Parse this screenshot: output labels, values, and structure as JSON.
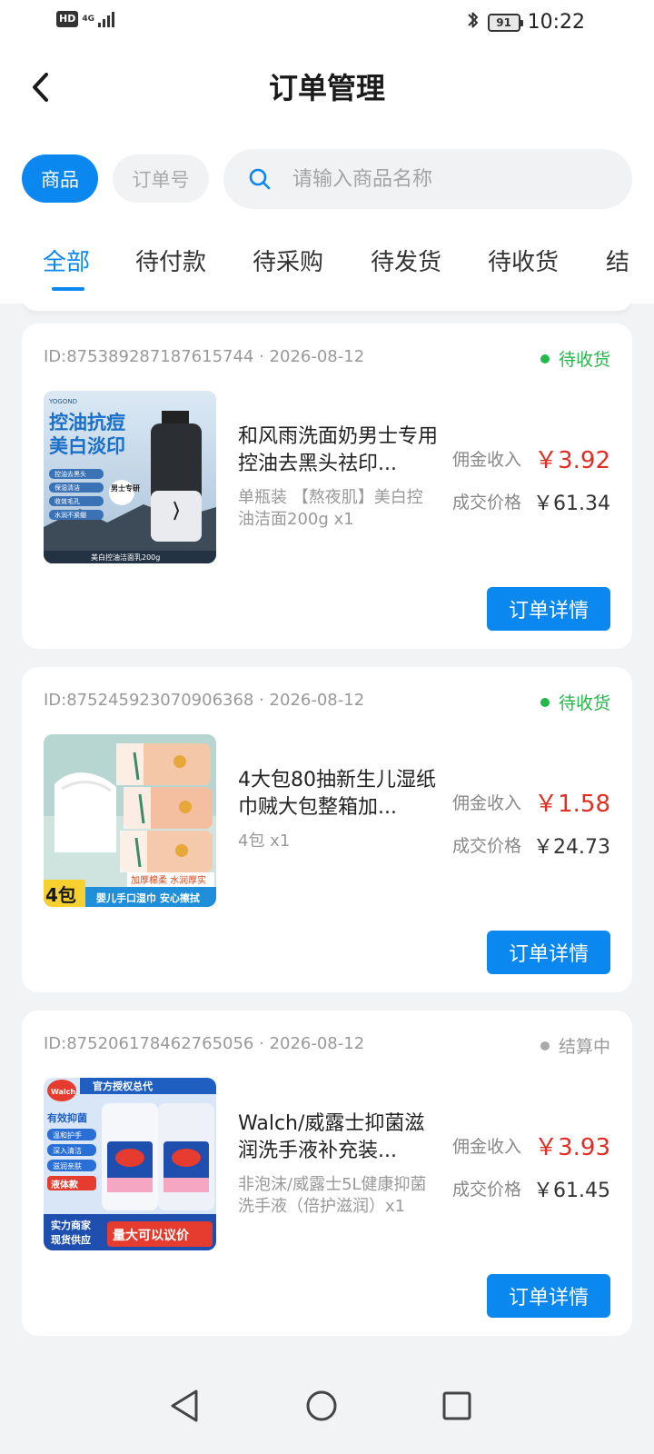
{
  "status_bar": {
    "network": "4G",
    "hd": "HD",
    "battery": "91",
    "time": "10:22"
  },
  "header": {
    "title": "订单管理"
  },
  "search": {
    "mode_goods": "商品",
    "mode_order_no": "订单号",
    "placeholder": "请输入商品名称"
  },
  "tabs": [
    "全部",
    "待付款",
    "待采购",
    "待发货",
    "待收货",
    "结"
  ],
  "labels": {
    "commission": "佣金收入",
    "deal_price": "成交价格",
    "detail_button": "订单详情"
  },
  "orders": [
    {
      "id_line": "ID:875389287187615744 · 2026-08-12",
      "status": "待收货",
      "status_color": "#22b84a",
      "name": "和风雨洗面奶男士专用控油去黑头祛印...",
      "sku": "单瓶装 【熬夜肌】美白控油洁面200g x1",
      "commission": "￥3.92",
      "price": "￥61.34",
      "image": {
        "brand": "YOGOND",
        "l1": "控油抗痘",
        "l2": "美白淡印",
        "f1": "控油去黑头",
        "f2": "保湿清洁",
        "f3": "收敛毛孔",
        "f4": "水润不紧绷",
        "badge": "男士专研",
        "caption": "美白控油洁面乳200g"
      }
    },
    {
      "id_line": "ID:875245923070906368 · 2026-08-12",
      "status": "待收货",
      "status_color": "#22b84a",
      "name": "4大包80抽新生儿湿纸巾贼大包整箱加...",
      "sku": "4包 x1",
      "commission": "￥1.58",
      "price": "￥24.73",
      "image": {
        "big": "4包",
        "tag": "加厚棉柔 水润厚实",
        "caption": "婴儿手口湿巾 安心擦拭"
      }
    },
    {
      "id_line": "ID:875206178462765056 · 2026-08-12",
      "status": "结算中",
      "status_color": "#aaaaaa",
      "name": "Walch/威露士抑菌滋润洗手液补充装...",
      "sku": "非泡沫/威露士5L健康抑菌洗手液（倍护滋润）x1",
      "commission": "￥3.93",
      "price": "￥61.45",
      "image": {
        "top": "官方授权总代",
        "brand": "Walch",
        "f0": "有效抑菌",
        "f1": "温和护手",
        "f2": "深入清洁",
        "f3": "滋润亲肤",
        "f4": "液体款",
        "b1": "实力商家",
        "b2": "现货供应",
        "b3": "量大可以议价"
      }
    }
  ]
}
